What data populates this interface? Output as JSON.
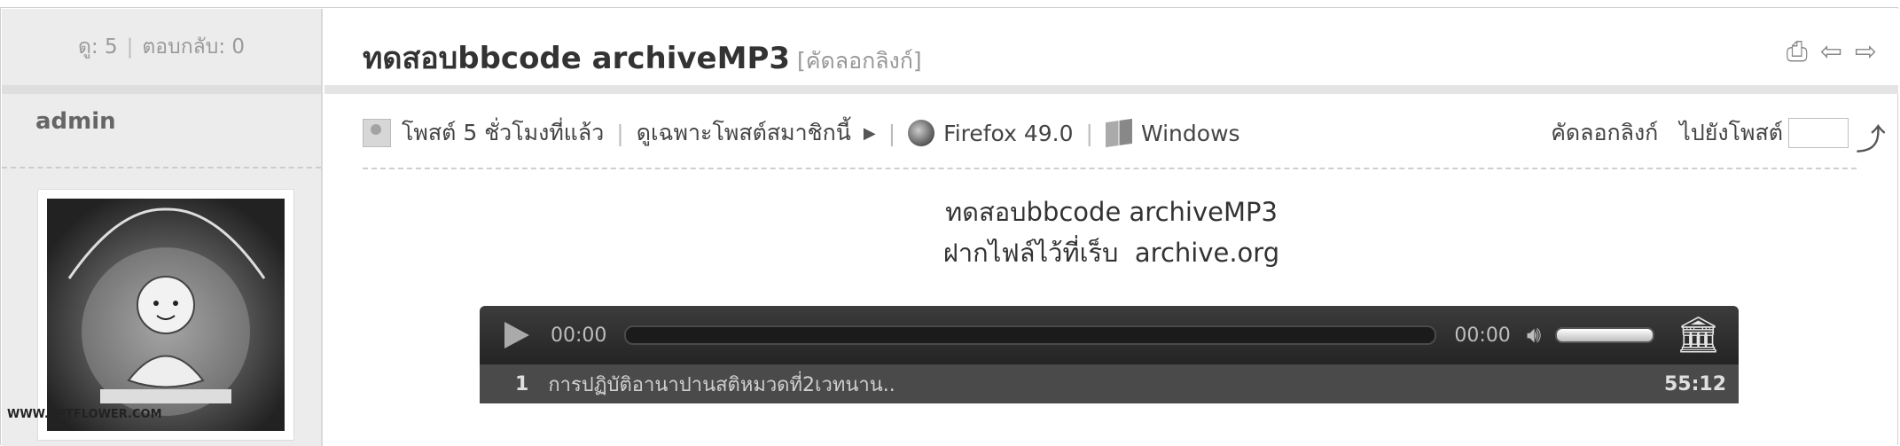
{
  "stats": {
    "views": "ดู: 5",
    "replies": "ตอบกลับ: 0"
  },
  "thread": {
    "title": "ทดสอบbbcode archiveMP3",
    "copy_link": "[คัดลอกลิงก์]"
  },
  "toolbar": {
    "print_icon": "printer-icon",
    "prev_icon": "arrow-left-icon",
    "next_icon": "arrow-right-icon"
  },
  "author": {
    "name": "admin",
    "avatar_caption": "WWW.PPTFLOWER.COM"
  },
  "postinfo": {
    "posted": "โพสต์ 5 ชั่วโมงที่แล้ว",
    "only_member": "ดูเฉพาะโพสต์สมาชิกนี้",
    "browser": "Firefox 49.0",
    "os": "Windows"
  },
  "rightnav": {
    "copy_link": "คัดลอกลิงก์",
    "goto_post": "ไปยังโพสต์",
    "goto_value": ""
  },
  "content": {
    "line1": "ทดสอบbbcode archiveMP3",
    "line2": "ฝากไฟล์ไว้ที่เร็บ  archive.org"
  },
  "player": {
    "current_time": "00:00",
    "total_time": "00:00",
    "progress": 0,
    "volume": 1,
    "playlist": [
      {
        "num": "1",
        "title": "การปฏิบัติอานาปานสติหมวดที่2เวทนาน..",
        "duration": "55:12"
      }
    ]
  },
  "colors": {
    "player_bg": "#2c2c2c",
    "header_bg": "#ececec"
  }
}
